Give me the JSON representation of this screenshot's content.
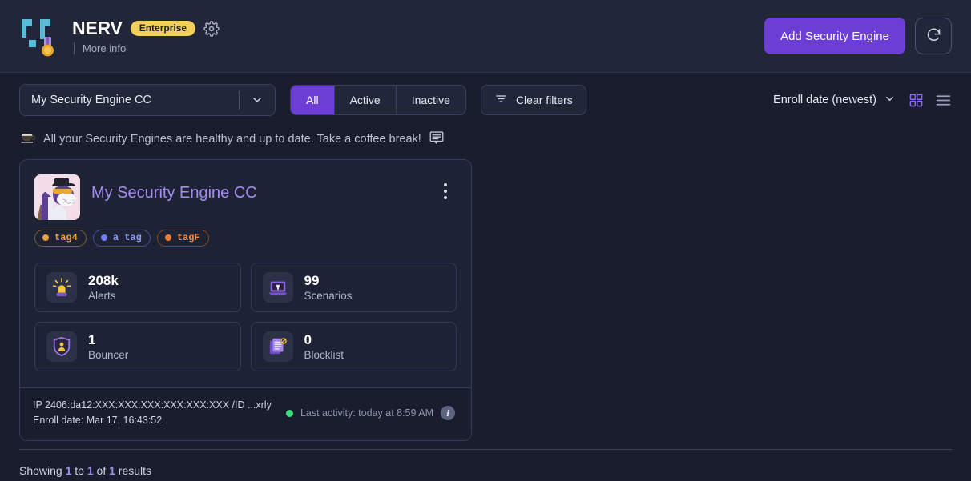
{
  "header": {
    "brand_name": "NERV",
    "plan_badge": "Enterprise",
    "more_info": "More info",
    "gear_icon": "gear-icon",
    "add_button": "Add Security Engine",
    "refresh_icon": "refresh-icon"
  },
  "toolbar": {
    "select_value": "My Security Engine CC",
    "caret_icon": "chevron-down-icon",
    "filters": [
      {
        "label": "All",
        "active": true
      },
      {
        "label": "Active",
        "active": false
      },
      {
        "label": "Inactive",
        "active": false
      }
    ],
    "clear_filters": "Clear filters",
    "clear_filters_icon": "filter-icon",
    "sort_label": "Enroll date (newest)",
    "grid_view_icon": "grid-view-icon",
    "list_view_icon": "list-view-icon",
    "grid_view_active_color": "#8a6de0",
    "list_view_color": "#9aa0ba"
  },
  "status": {
    "coffee_icon": "coffee-cup-icon",
    "message": "All your Security Engines are healthy and up to date. Take a coffee break!",
    "doc_icon": "document-lines-icon"
  },
  "card": {
    "avatar_icon": "llama-avatar",
    "title": "My Security Engine CC",
    "menu_icon": "kebab-menu-icon",
    "tags": [
      {
        "label": "tag4",
        "color": "#e8a33d"
      },
      {
        "label": "a tag",
        "color": "#6f7ef5"
      },
      {
        "label": "tagF",
        "color": "#ef7b33"
      }
    ],
    "stats": [
      {
        "value": "208k",
        "label": "Alerts",
        "icon": "siren-alert-icon"
      },
      {
        "value": "99",
        "label": "Scenarios",
        "icon": "laptop-scenario-icon"
      },
      {
        "value": "1",
        "label": "Bouncer",
        "icon": "shield-bouncer-icon"
      },
      {
        "value": "0",
        "label": "Blocklist",
        "icon": "blocklist-document-icon"
      }
    ],
    "footer": {
      "ip_line": "IP 2406:da12:XXX:XXX:XXX:XXX:XXX:XXX /ID ...xrly",
      "enroll_line": "Enroll date: Mar 17, 16:43:52",
      "status_dot_color": "#3ddc7f",
      "last_activity": "Last activity: today at 8:59 AM",
      "info_icon": "info-icon",
      "info_glyph": "i"
    }
  },
  "results": {
    "prefix": "Showing ",
    "from": "1",
    "mid1": " to ",
    "to": "1",
    "mid2": " of ",
    "total": "1",
    "suffix": " results"
  },
  "colors": {
    "accent_purple": "#6c3ed6",
    "badge_yellow": "#f2ce5b",
    "link_purple": "#a48cf0",
    "page_bg": "#191d2d",
    "header_bg": "#212639"
  }
}
